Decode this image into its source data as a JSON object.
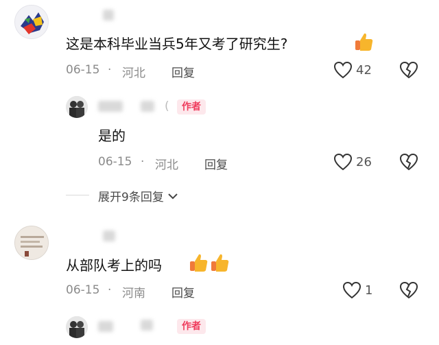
{
  "comments": [
    {
      "text": "这是本科毕业当兵5年又考了研究生?",
      "date": "06-15",
      "location": "河北",
      "reply_label": "回复",
      "likes": "42",
      "sep": "·"
    },
    {
      "text": "从部队考上的吗",
      "date": "06-15",
      "location": "河南",
      "reply_label": "回复",
      "likes": "1",
      "sep": "·"
    }
  ],
  "author_reply": {
    "badge": "作者",
    "paren": "(",
    "text": "是的",
    "date": "06-15",
    "location": "河北",
    "reply_label": "回复",
    "likes": "26",
    "sep": "·"
  },
  "expand_label": "展开9条回复",
  "bottom_author_badge": "作者",
  "colors": {
    "author_badge_text": "#ef3b5c",
    "author_badge_bg": "#fde8ec",
    "thumb_yellow": "#f7b52c",
    "thumb_cuff": "#f07a3a"
  },
  "icons": [
    "heart-icon",
    "broken-heart-icon",
    "thumbs-up-emoji",
    "chevron-down-icon"
  ]
}
